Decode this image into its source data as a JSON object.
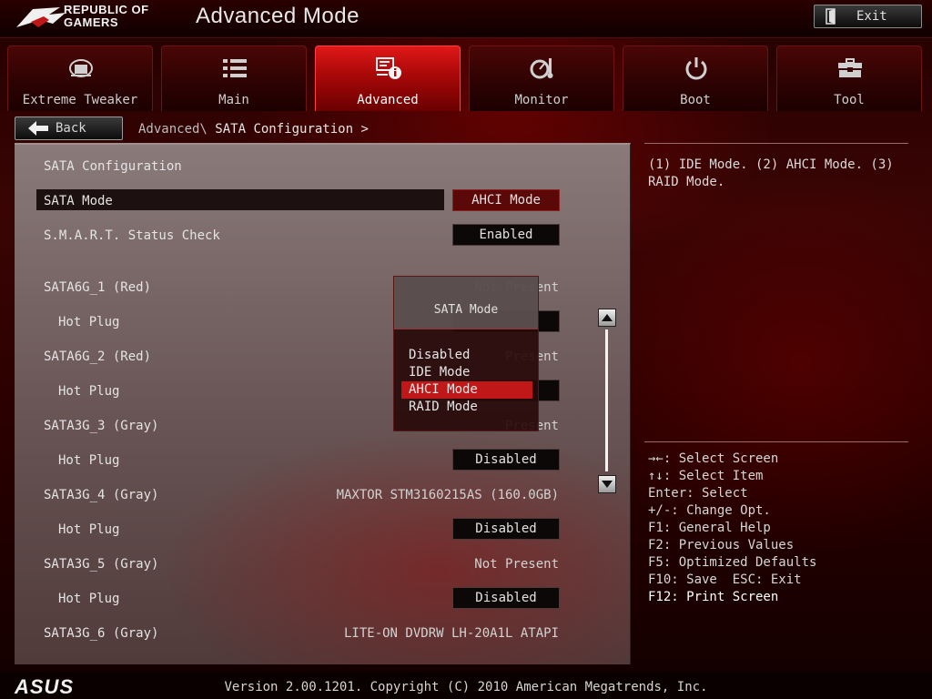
{
  "header": {
    "brand_line1": "REPUBLIC OF",
    "brand_line2": "GAMERS",
    "mode_title": "Advanced Mode",
    "exit_label": "Exit"
  },
  "tabs": [
    {
      "label": "Extreme Tweaker",
      "icon": "tweaker-icon",
      "active": false
    },
    {
      "label": "Main",
      "icon": "list-icon",
      "active": false
    },
    {
      "label": "Advanced",
      "icon": "advanced-info-icon",
      "active": true
    },
    {
      "label": "Monitor",
      "icon": "monitor-gauge-icon",
      "active": false
    },
    {
      "label": "Boot",
      "icon": "power-icon",
      "active": false
    },
    {
      "label": "Tool",
      "icon": "toolbox-icon",
      "active": false
    }
  ],
  "nav": {
    "back_label": "Back",
    "breadcrumb_prefix": "Advanced\\ ",
    "breadcrumb_current": "SATA Configuration >"
  },
  "main": {
    "section_title": "SATA Configuration",
    "rows": [
      {
        "label": "SATA Mode",
        "value": "AHCI Mode"
      },
      {
        "label": "S.M.A.R.T. Status Check",
        "value": "Enabled"
      },
      {
        "label": "SATA6G_1 (Red)",
        "value": "Not Present"
      },
      {
        "label": "Hot Plug",
        "value": ""
      },
      {
        "label": "SATA6G_2 (Red)",
        "value": "Present"
      },
      {
        "label": "Hot Plug",
        "value": ""
      },
      {
        "label": "SATA3G_3 (Gray)",
        "value": "Present"
      },
      {
        "label": "Hot Plug",
        "value": "Disabled"
      },
      {
        "label": "SATA3G_4 (Gray)",
        "value": "MAXTOR STM3160215AS (160.0GB)"
      },
      {
        "label": "Hot Plug",
        "value": "Disabled"
      },
      {
        "label": "SATA3G_5 (Gray)",
        "value": "Not Present"
      },
      {
        "label": "Hot Plug",
        "value": "Disabled"
      },
      {
        "label": "SATA3G_6 (Gray)",
        "value": "LITE-ON DVDRW LH-20A1L ATAPI"
      }
    ]
  },
  "popup": {
    "title": "SATA Mode",
    "options": [
      "Disabled",
      "IDE Mode",
      "AHCI Mode",
      "RAID Mode"
    ],
    "selected": "AHCI Mode"
  },
  "help": {
    "description": "(1) IDE Mode. (2) AHCI Mode. (3) RAID Mode.",
    "keys": [
      "→←: Select Screen",
      "↑↓: Select Item",
      "Enter: Select",
      "+/-: Change Opt.",
      "F1: General Help",
      "F2: Previous Values",
      "F5: Optimized Defaults",
      "F10: Save  ESC: Exit",
      "F12: Print Screen"
    ]
  },
  "footer": {
    "brand": "ASUS",
    "version": "Version 2.00.1201. Copyright (C) 2010 American Megatrends, Inc."
  },
  "colors": {
    "accent_red": "#c01818",
    "active_tab": "#e01818",
    "background": "#2a0000"
  }
}
